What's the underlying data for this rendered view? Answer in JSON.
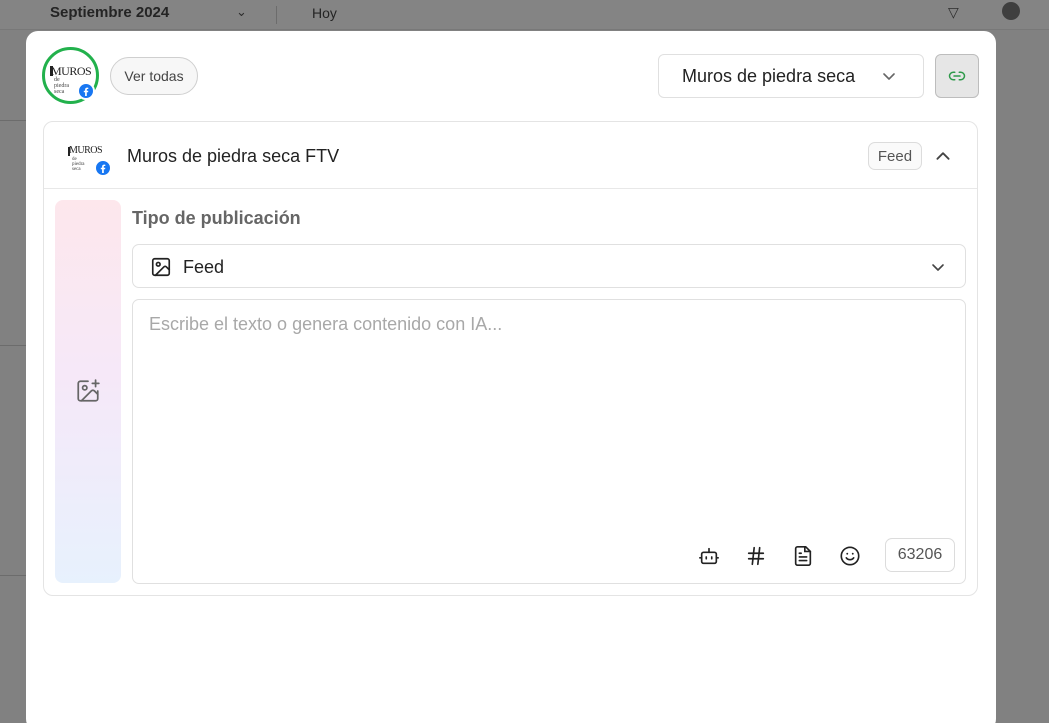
{
  "background": {
    "month_label": "Septiembre 2024",
    "view_label": "Hoy"
  },
  "header": {
    "see_all_label": "Ver todas",
    "account_select_value": "Muros de piedra seca",
    "logo_text": "MUROS",
    "logo_subtext": "de piedra seca"
  },
  "post": {
    "page_name": "Muros de piedra seca FTV",
    "type_badge": "Feed",
    "publication_type_label": "Tipo de publicación",
    "publication_type_value": "Feed",
    "text_placeholder": "Escribe el texto o genera contenido con IA...",
    "char_counter": "63206"
  },
  "icons": {
    "social_network": "facebook-icon",
    "link": "link-icon",
    "add_media": "image-plus-icon",
    "ai": "robot-icon",
    "hashtag": "hashtag-icon",
    "template": "document-icon",
    "emoji": "smiley-icon"
  },
  "colors": {
    "facebook": "#1877f2",
    "connected_ring": "#22b14c",
    "link_icon": "#2e9a4a"
  }
}
